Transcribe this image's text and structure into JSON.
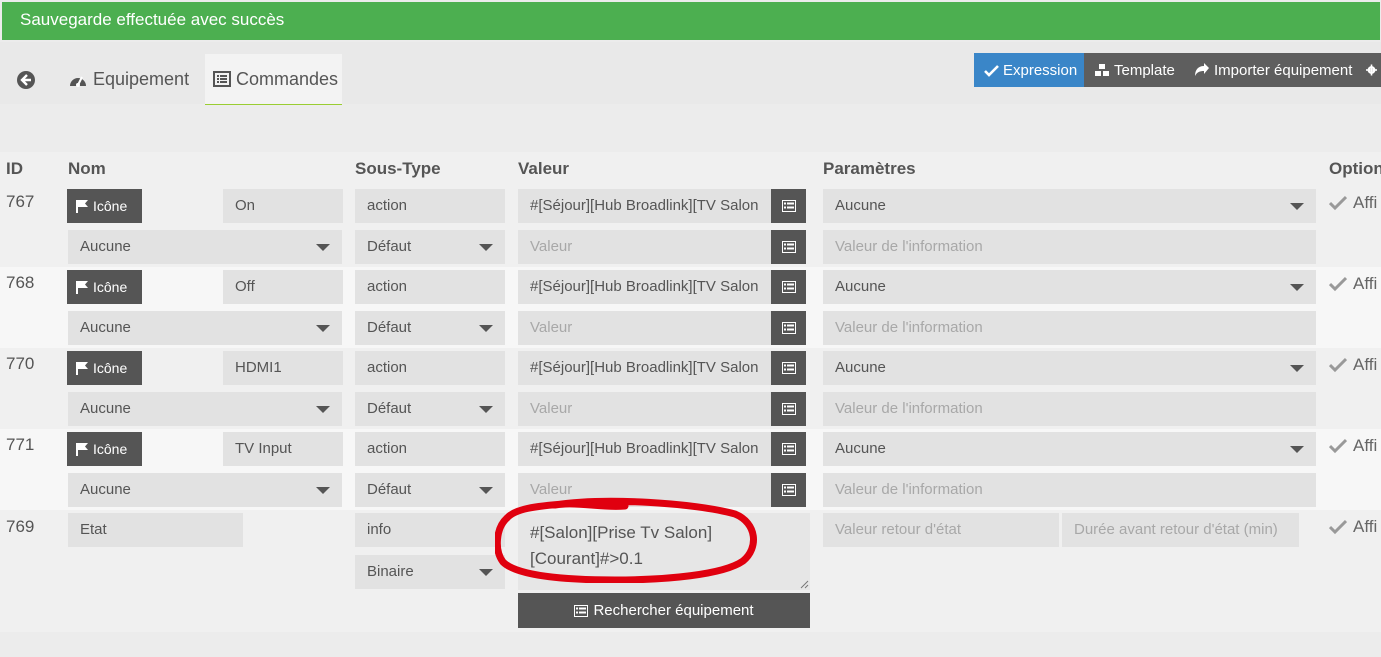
{
  "alert": {
    "text": "Sauvegarde effectuée avec succès",
    "color": "#4caf50"
  },
  "tabs": {
    "equipement": "Equipement",
    "commandes": "Commandes"
  },
  "toolbar": {
    "expression": "Expression",
    "template": "Template",
    "importer": "Importer équipement",
    "accent": "#3a86c8"
  },
  "headers": {
    "id": "ID",
    "nom": "Nom",
    "sous_type": "Sous-Type",
    "valeur": "Valeur",
    "parametres": "Paramètres",
    "options": "Option"
  },
  "icon_button_label": "Icône",
  "commands": [
    {
      "id": "767",
      "name": "On",
      "type": "action",
      "subtype": "Défaut",
      "value": "#[Séjour][Hub Broadlink][TV Salon",
      "value_placeholder": "Valeur",
      "generic": "Aucune",
      "param": "Aucune",
      "param_placeholder": "Valeur de l'information",
      "option": "Affi"
    },
    {
      "id": "768",
      "name": "Off",
      "type": "action",
      "subtype": "Défaut",
      "value": "#[Séjour][Hub Broadlink][TV Salon",
      "value_placeholder": "Valeur",
      "generic": "Aucune",
      "param": "Aucune",
      "param_placeholder": "Valeur de l'information",
      "option": "Affi"
    },
    {
      "id": "770",
      "name": "HDMI1",
      "type": "action",
      "subtype": "Défaut",
      "value": "#[Séjour][Hub Broadlink][TV Salon",
      "value_placeholder": "Valeur",
      "generic": "Aucune",
      "param": "Aucune",
      "param_placeholder": "Valeur de l'information",
      "option": "Affi"
    },
    {
      "id": "771",
      "name": "TV Input",
      "type": "action",
      "subtype": "Défaut",
      "value": "#[Séjour][Hub Broadlink][TV Salon",
      "value_placeholder": "Valeur",
      "generic": "Aucune",
      "param": "Aucune",
      "param_placeholder": "Valeur de l'information",
      "option": "Affi"
    }
  ],
  "info_command": {
    "id": "769",
    "name": "Etat",
    "type": "info",
    "subtype": "Binaire",
    "calc_line1": "#[Salon][Prise Tv Salon]",
    "calc_line2": "[Courant]#>0.1",
    "return_state_placeholder": "Valeur retour d'état",
    "return_delay_placeholder": "Durée avant retour d'état (min)",
    "search_button": "Rechercher équipement",
    "option": "Affi",
    "highlight_color": "#e0000f"
  }
}
